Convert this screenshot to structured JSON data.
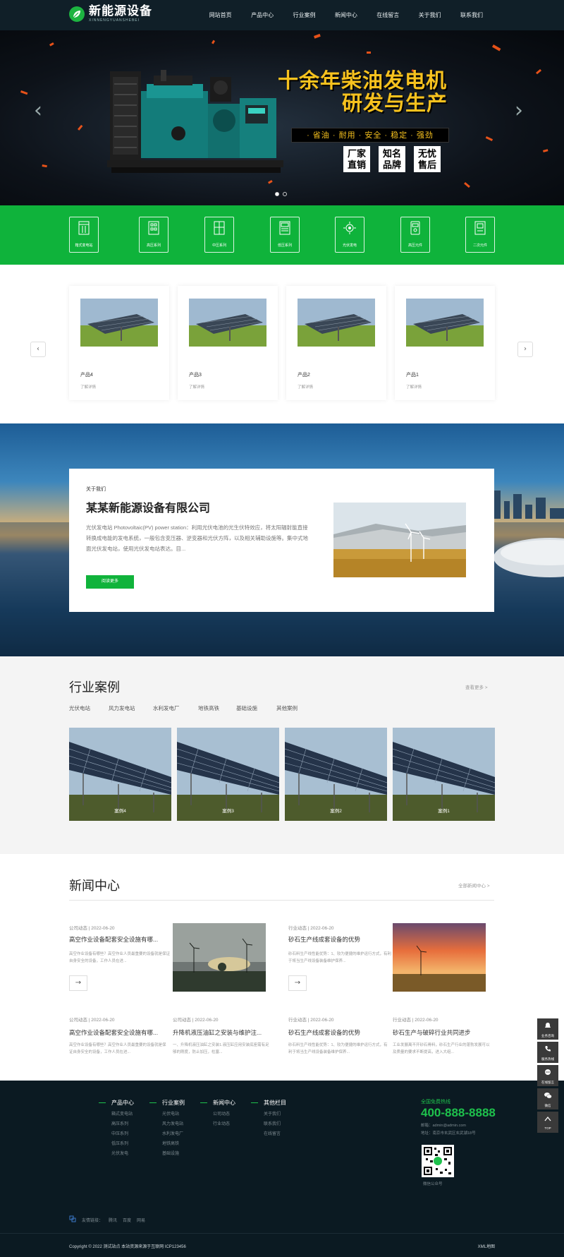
{
  "header": {
    "logo_cn": "新能源设备",
    "logo_en": "XINNENGYUANSHEBEI",
    "nav": [
      "网站首页",
      "产品中心",
      "行业案例",
      "新闻中心",
      "在线留言",
      "关于我们",
      "联系我们"
    ]
  },
  "banner": {
    "title_line1": "十余年柴油发电机",
    "title_line2": "研发与生产",
    "strip": "· 省油 · 耐用 · 安全 · 稳定 · 强劲",
    "tags": [
      [
        "厂家",
        "直销"
      ],
      [
        "知名",
        "品牌"
      ],
      [
        "无忧",
        "售后"
      ]
    ],
    "prev": "‹",
    "next": "›"
  },
  "categories": [
    "箱式变电站",
    "高压系列",
    "中压系列",
    "低压系列",
    "光伏发电",
    "高压元件",
    "二次元件"
  ],
  "products": {
    "items": [
      {
        "name": "产品4",
        "more": "了解详情"
      },
      {
        "name": "产品3",
        "more": "了解详情"
      },
      {
        "name": "产品2",
        "more": "了解详情"
      },
      {
        "name": "产品1",
        "more": "了解详情"
      }
    ],
    "prev": "‹",
    "next": "›"
  },
  "about": {
    "label": "关于我们",
    "title": "某某新能源设备有限公司",
    "text": "光伏发电站 Photovoltaic(PV) power station：利用光伏电池的光生伏特效应，将太阳辐射能直接转换成电能的发电系统，一般包含变压器、逆变器和光伏方阵，以及相关辅助设施等。集中式地面光伏发电站，使用光伏发电站表达。目...",
    "button": "阅读更多"
  },
  "cases": {
    "title": "行业案例",
    "more": "查看更多 >",
    "tabs": [
      "光伏电站",
      "风力发电站",
      "水利发电厂",
      "地铁高铁",
      "基础设施",
      "其他案例"
    ],
    "items": [
      "案例4",
      "案例3",
      "案例2",
      "案例1"
    ]
  },
  "news": {
    "title": "新闻中心",
    "more": "全部新闻中心 >",
    "featured": [
      {
        "meta": "公司动态 | 2022-06-20",
        "title": "高空作业设备配套安全设施有哪...",
        "desc": "高空作业设备有哪些？高空作业人员最重要的设备就是保证自身安全的设备，工作人员在进..."
      },
      {
        "meta": "行业动态 | 2022-06-20",
        "title": "砂石生产线成套设备的优势",
        "desc": "砂石料生产线性能优势：1、较为便捷的维护运行方式，有利于将当生产线设备装备维护保养..."
      }
    ],
    "list": [
      {
        "meta": "公司动态 | 2022-06-20",
        "title": "高空作业设备配套安全设施有哪...",
        "desc": "高空作业设备有哪些？高空作业人员最重要的设备就是保证自身安全的设备，工作人员在进..."
      },
      {
        "meta": "公司动态 | 2022-06-20",
        "title": "升降机液压油缸之安装与维护注...",
        "desc": "一、升降机液压油缸之安装1.液压缸应用安装底座需有足够的刚度，防止加压，柱塞..."
      },
      {
        "meta": "行业动态 | 2022-06-20",
        "title": "砂石生产线成套设备的优势",
        "desc": "砂石料生产线性能优势：1、较为便捷的维护运行方式，有利于将当生产线设备装备维护保养..."
      },
      {
        "meta": "行业动态 | 2022-06-20",
        "title": "砂石生产与破碎行业共同进步",
        "desc": "工业发展离不开砂石骨料，砂石生产行业的蓬勃发展可以及质量的要求不断提高，进入大组..."
      }
    ]
  },
  "footer": {
    "columns": [
      {
        "head": "产品中心",
        "items": [
          "箱式变电站",
          "高压系列",
          "中压系列",
          "低压系列",
          "光伏发电"
        ]
      },
      {
        "head": "行业案例",
        "items": [
          "光伏电站",
          "风力发电站",
          "水利发电厂",
          "地铁高铁",
          "基础设施"
        ]
      },
      {
        "head": "新闻中心",
        "items": [
          "公司动态",
          "行业动态"
        ]
      },
      {
        "head": "其他栏目",
        "items": [
          "关于我们",
          "联系我们",
          "在线留言"
        ]
      }
    ],
    "hotline_label": "全国免费热线",
    "hotline": "400-888-8888",
    "email": "邮箱：admin@admin.com",
    "address": "地址：南京市玄武区玄武湖18号",
    "qr_label": "微信公众号",
    "links_label": "友情链接：",
    "links": [
      "腾讯",
      "百度",
      "网易"
    ],
    "copyright": "Copyright © 2022 测试站点 本站资源来源于互联网 ICP123456",
    "xml": "XML地图"
  },
  "side": [
    "业务咨询",
    "服务热线",
    "在线留言",
    "微信",
    "TOP"
  ]
}
